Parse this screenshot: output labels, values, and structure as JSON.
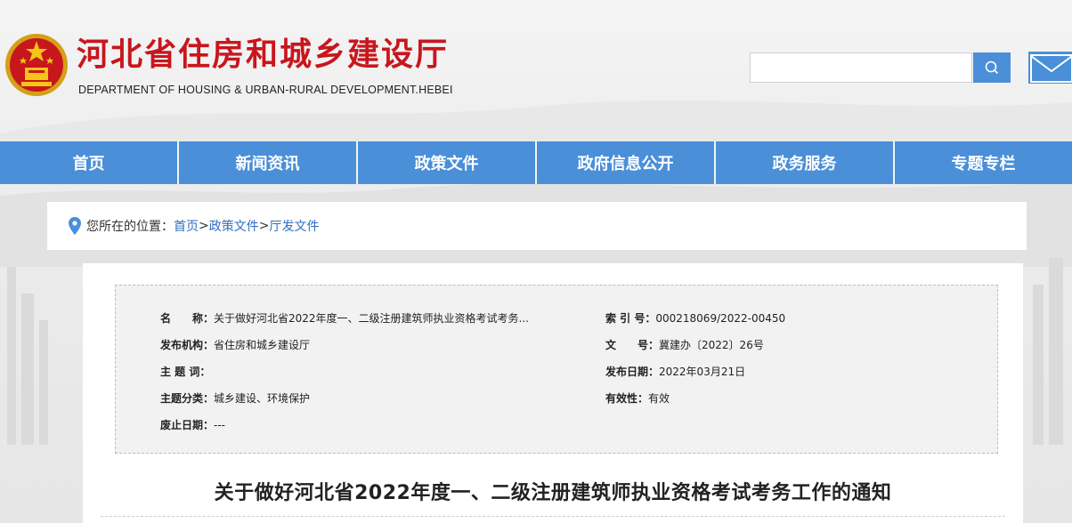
{
  "header": {
    "title": "河北省住房和城乡建设厅",
    "subtitle": "DEPARTMENT OF HOUSING & URBAN-RURAL DEVELOPMENT.HEBEI",
    "search": {
      "value": "",
      "placeholder": ""
    }
  },
  "nav": {
    "items": [
      {
        "label": "首页"
      },
      {
        "label": "新闻资讯"
      },
      {
        "label": "政策文件"
      },
      {
        "label": "政府信息公开"
      },
      {
        "label": "政务服务"
      },
      {
        "label": "专题专栏"
      }
    ]
  },
  "breadcrumb": {
    "prefix": "您所在的位置：",
    "items": [
      "首页",
      "政策文件",
      "厅发文件"
    ],
    "separator": ">"
  },
  "info": {
    "name_label": "名　　称：",
    "name_value": "关于做好河北省2022年度一、二级注册建筑师执业资格考试考务...",
    "index_label": "索 引 号：",
    "index_value": "000218069/2022-00450",
    "issuer_label": "发布机构：",
    "issuer_value": "省住房和城乡建设厅",
    "docno_label": "文　　号：",
    "docno_value": "冀建办〔2022〕26号",
    "keywords_label": "主 题 词：",
    "keywords_value": "",
    "date_label": "发布日期：",
    "date_value": "2022年03月21日",
    "category_label": "主题分类：",
    "category_value": "城乡建设、环境保护",
    "validity_label": "有效性：",
    "validity_value": "有效",
    "expiry_label": "废止日期：",
    "expiry_value": "---"
  },
  "article": {
    "title": "关于做好河北省2022年度一、二级注册建筑师执业资格考试考务工作的通知"
  },
  "colors": {
    "brand_red": "#c8161d",
    "nav_blue": "#4a8fd8",
    "link_blue": "#2f6fc2"
  },
  "icons": [
    "national-emblem-icon",
    "search-icon",
    "mail-icon",
    "location-pin-icon"
  ]
}
